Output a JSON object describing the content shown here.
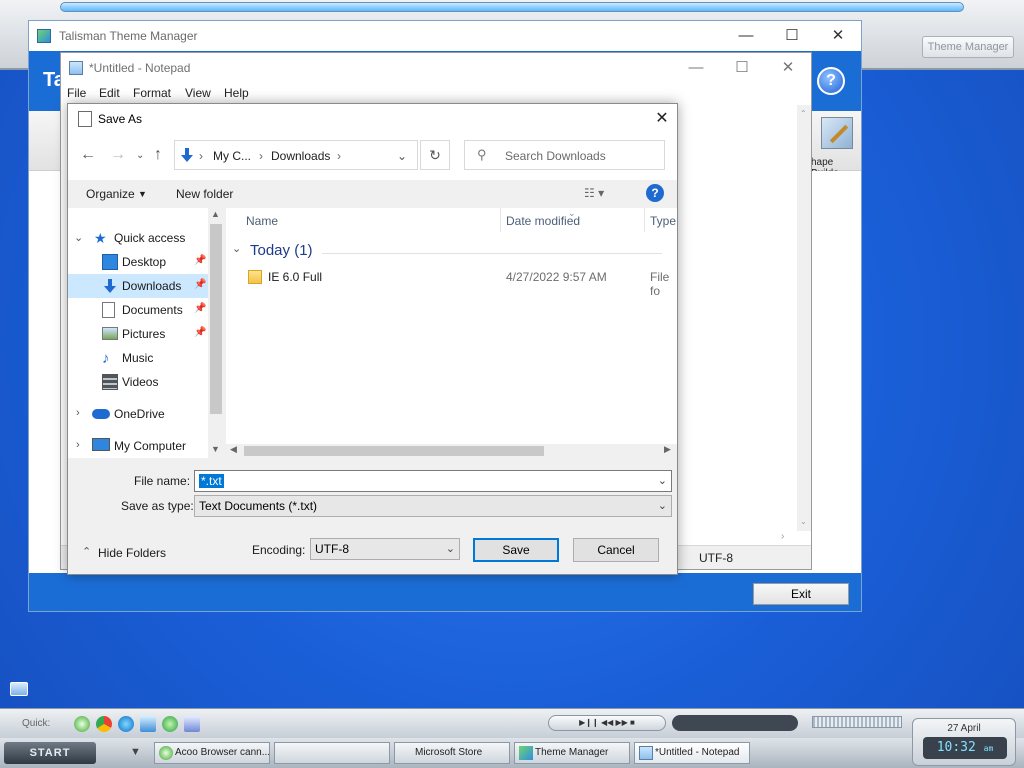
{
  "top_bar": {
    "theme_manager_button": "Theme Manager"
  },
  "talisman": {
    "title": "Talisman Theme Manager",
    "banner_initial": "Ta",
    "help_glyph": "?",
    "tool_label": "hape Builde",
    "exit_label": "Exit"
  },
  "notepad": {
    "title": "*Untitled - Notepad",
    "menu": [
      "File",
      "Edit",
      "Format",
      "View",
      "Help"
    ],
    "status_encoding": "UTF-8"
  },
  "save_as": {
    "title": "Save As",
    "breadcrumb": [
      "My C...",
      "Downloads"
    ],
    "search_placeholder": "Search Downloads",
    "organize_label": "Organize",
    "new_folder_label": "New folder",
    "help_glyph": "?",
    "tree": {
      "quick_access": "Quick access",
      "items": [
        {
          "label": "Desktop",
          "pinned": true
        },
        {
          "label": "Downloads",
          "pinned": true,
          "selected": true
        },
        {
          "label": "Documents",
          "pinned": true
        },
        {
          "label": "Pictures",
          "pinned": true
        },
        {
          "label": "Music",
          "pinned": false
        },
        {
          "label": "Videos",
          "pinned": false
        }
      ],
      "onedrive": "OneDrive",
      "my_computer": "My Computer"
    },
    "columns": [
      "Name",
      "Date modified",
      "Type"
    ],
    "group": "Today (1)",
    "files": [
      {
        "name": "IE 6.0 Full",
        "date": "4/27/2022 9:57 AM",
        "type": "File fo"
      }
    ],
    "file_name_label": "File name:",
    "file_name_value": "*.txt",
    "save_type_label": "Save as type:",
    "save_type_value": "Text Documents (*.txt)",
    "hide_folders_label": "Hide Folders",
    "encoding_label": "Encoding:",
    "encoding_value": "UTF-8",
    "save_label": "Save",
    "cancel_label": "Cancel"
  },
  "quickbar": {
    "label": "Quick:"
  },
  "taskbar": {
    "start_label": "START",
    "tasks": [
      {
        "label": "Acoo Browser cann...",
        "active": false
      },
      {
        "label": "",
        "active": false
      },
      {
        "label": "Microsoft Store",
        "active": false
      },
      {
        "label": "Theme Manager",
        "active": false
      },
      {
        "label": "*Untitled - Notepad",
        "active": true
      }
    ],
    "clock_date": "27 April",
    "clock_time": "10:32",
    "clock_ampm": "am"
  }
}
